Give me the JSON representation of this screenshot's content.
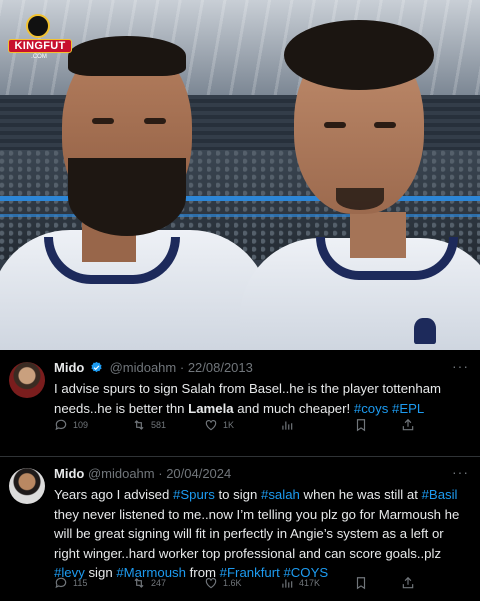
{
  "photo": {
    "watermark": "KINGFUT",
    "watermark_sub": ".COM"
  },
  "tweets": [
    {
      "name": "Mido",
      "handle": "@midoahm",
      "date": "22/08/2013",
      "verified": true,
      "text_parts": [
        {
          "t": "I advise spurs to sign Salah from Basel..he is the player tottenham needs..he is better thn ",
          "k": "text"
        },
        {
          "t": "Lamela",
          "k": "bold"
        },
        {
          "t": " and much cheaper! ",
          "k": "text"
        },
        {
          "t": "#coys",
          "k": "tag"
        },
        {
          "t": " ",
          "k": "text"
        },
        {
          "t": "#EPL",
          "k": "tag"
        }
      ],
      "replies": "109",
      "retweets": "581",
      "likes": "1K",
      "views": ""
    },
    {
      "name": "Mido",
      "handle": "@midoahm",
      "date": "20/04/2024",
      "verified": false,
      "text_parts": [
        {
          "t": "Years ago I advised ",
          "k": "text"
        },
        {
          "t": "#Spurs",
          "k": "tag"
        },
        {
          "t": " to sign ",
          "k": "text"
        },
        {
          "t": "#salah",
          "k": "tag"
        },
        {
          "t": " when he was still at ",
          "k": "text"
        },
        {
          "t": "#Basil",
          "k": "tag"
        },
        {
          "t": " they never listened to me..now I’m telling you plz go for Marmoush he will be great signing will fit in perfectly in Angie’s system as a left or right winger..hard worker top professional and can score goals..plz ",
          "k": "text"
        },
        {
          "t": "#levy",
          "k": "tag"
        },
        {
          "t": " sign ",
          "k": "text"
        },
        {
          "t": "#Marmoush",
          "k": "tag"
        },
        {
          "t": " from ",
          "k": "text"
        },
        {
          "t": "#Frankfurt",
          "k": "tag"
        },
        {
          "t": " ",
          "k": "text"
        },
        {
          "t": "#COYS",
          "k": "tag"
        }
      ],
      "replies": "115",
      "retweets": "247",
      "likes": "1.6K",
      "views": "417K"
    }
  ],
  "colors": {
    "accent": "#1d9bf0",
    "muted": "#71767b",
    "text": "#e7e9ea"
  }
}
